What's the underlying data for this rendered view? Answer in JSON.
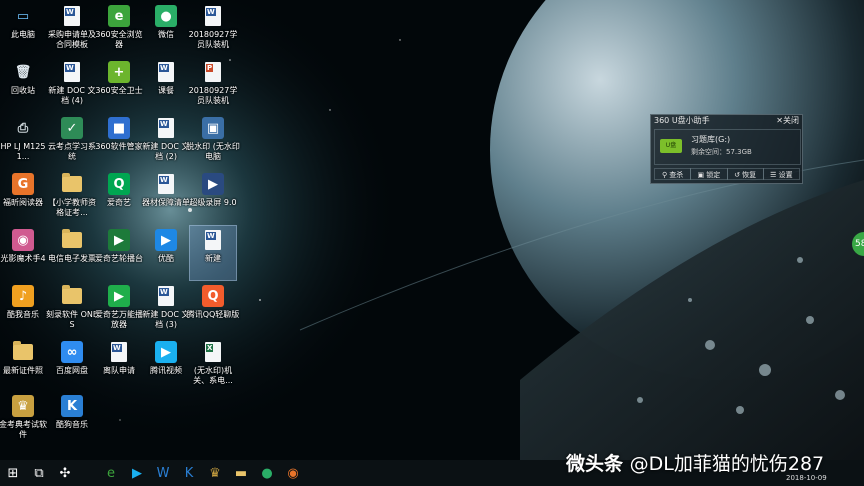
{
  "desktop_icons": [
    {
      "label": "此电脑",
      "kind": "computer"
    },
    {
      "label": "采购申请单及合同模板",
      "kind": "doc"
    },
    {
      "label": "360安全浏览器",
      "kind": "app",
      "color": "#3ca43c",
      "glyph": "e"
    },
    {
      "label": "微信",
      "kind": "app",
      "color": "#2aae67",
      "glyph": "●"
    },
    {
      "label": "20180927学员队装机",
      "kind": "doc"
    },
    {
      "label": "回收站",
      "kind": "recycle"
    },
    {
      "label": "新建 DOC 文档 (4)",
      "kind": "doc"
    },
    {
      "label": "360安全卫士",
      "kind": "app",
      "color": "#6cb52d",
      "glyph": "+"
    },
    {
      "label": "课餐",
      "kind": "doc"
    },
    {
      "label": "20180927学员队装机",
      "kind": "pdf"
    },
    {
      "label": "HP LJ M1251...",
      "kind": "printer"
    },
    {
      "label": "云考点学习系统",
      "kind": "app",
      "color": "#2e8b57",
      "glyph": "✓"
    },
    {
      "label": "360软件管家",
      "kind": "app",
      "color": "#2f6fd0",
      "glyph": "■"
    },
    {
      "label": "新建 DOC 文档 (2)",
      "kind": "doc"
    },
    {
      "label": "脱水印 (无水印电脑",
      "kind": "app",
      "color": "#3a6ea5",
      "glyph": "▣"
    },
    {
      "label": "福昕阅读器",
      "kind": "app",
      "color": "#e8742a",
      "glyph": "G"
    },
    {
      "label": "【小学教师资格证考...",
      "kind": "folder"
    },
    {
      "label": "爱奇艺",
      "kind": "app",
      "color": "#00a651",
      "glyph": "Q"
    },
    {
      "label": "器材保障清单",
      "kind": "doc"
    },
    {
      "label": "超级录屏 9.0",
      "kind": "app",
      "color": "#2a4a80",
      "glyph": "▶"
    },
    {
      "label": "光影魔术手4",
      "kind": "app",
      "color": "#d05a90",
      "glyph": "◉"
    },
    {
      "label": "电信电子发票",
      "kind": "folder"
    },
    {
      "label": "爱奇艺轮播台",
      "kind": "app",
      "color": "#1d7a3a",
      "glyph": "▶"
    },
    {
      "label": "优酷",
      "kind": "app",
      "color": "#1e88e5",
      "glyph": "▶"
    },
    {
      "label": "新建",
      "kind": "doc",
      "selected": true
    },
    {
      "label": "酷我音乐",
      "kind": "app",
      "color": "#f0a020",
      "glyph": "♪"
    },
    {
      "label": "刻录软件 ONES",
      "kind": "folder"
    },
    {
      "label": "爱奇艺万能播放器",
      "kind": "app",
      "color": "#1fae4b",
      "glyph": "▶"
    },
    {
      "label": "新建 DOC 文档 (3)",
      "kind": "doc"
    },
    {
      "label": "腾讯QQ轻聊版",
      "kind": "app",
      "color": "#f25c2c",
      "glyph": "Q"
    },
    {
      "label": "最新证件照",
      "kind": "folder"
    },
    {
      "label": "百度网盘",
      "kind": "app",
      "color": "#2f8cf0",
      "glyph": "∞"
    },
    {
      "label": "离队申请",
      "kind": "doc"
    },
    {
      "label": "腾讯视频",
      "kind": "app",
      "color": "#1ab0f0",
      "glyph": "▶"
    },
    {
      "label": "(无水印)机关、系电...",
      "kind": "xls"
    },
    {
      "label": "金考典考试软件",
      "kind": "app",
      "color": "#c8a040",
      "glyph": "♛"
    },
    {
      "label": "酷狗音乐",
      "kind": "app",
      "color": "#2a7fd4",
      "glyph": "K"
    }
  ],
  "usb_helper": {
    "title": "360 U盘小助手",
    "close_label": "关闭",
    "drive_badge": "U盘",
    "drive_name": "习题库(G:)",
    "free_space": "剩余空间：57.3GB",
    "actions": [
      {
        "label": "查杀",
        "icon": "search-icon"
      },
      {
        "label": "锁定",
        "icon": "lock-icon"
      },
      {
        "label": "恢复",
        "icon": "restore-icon"
      },
      {
        "label": "设置",
        "icon": "menu-icon"
      }
    ]
  },
  "taskbar": {
    "items": [
      {
        "name": "start",
        "glyph": "⊞",
        "color": "#ffffff"
      },
      {
        "name": "task-view",
        "glyph": "⧉",
        "color": "#ffffff"
      },
      {
        "name": "fan",
        "glyph": "✣",
        "color": "#ffffff"
      },
      {
        "name": "360-browser",
        "glyph": "e",
        "color": "#3ca43c"
      },
      {
        "name": "tencent-video",
        "glyph": "▶",
        "color": "#1ab0f0"
      },
      {
        "name": "w-app",
        "glyph": "W",
        "color": "#2a7fd4"
      },
      {
        "name": "kugou",
        "glyph": "K",
        "color": "#2a7fd4"
      },
      {
        "name": "shirt",
        "glyph": "♛",
        "color": "#c8a040"
      },
      {
        "name": "explorer",
        "glyph": "▬",
        "color": "#e9c46a"
      },
      {
        "name": "wechat",
        "glyph": "●",
        "color": "#2aae67"
      },
      {
        "name": "media",
        "glyph": "◉",
        "color": "#e8742a"
      }
    ],
    "date": "2018-10-09"
  },
  "watermark": {
    "brand": "微头条",
    "handle": "@DL加菲猫的忧伤287"
  },
  "side_badge": "58"
}
